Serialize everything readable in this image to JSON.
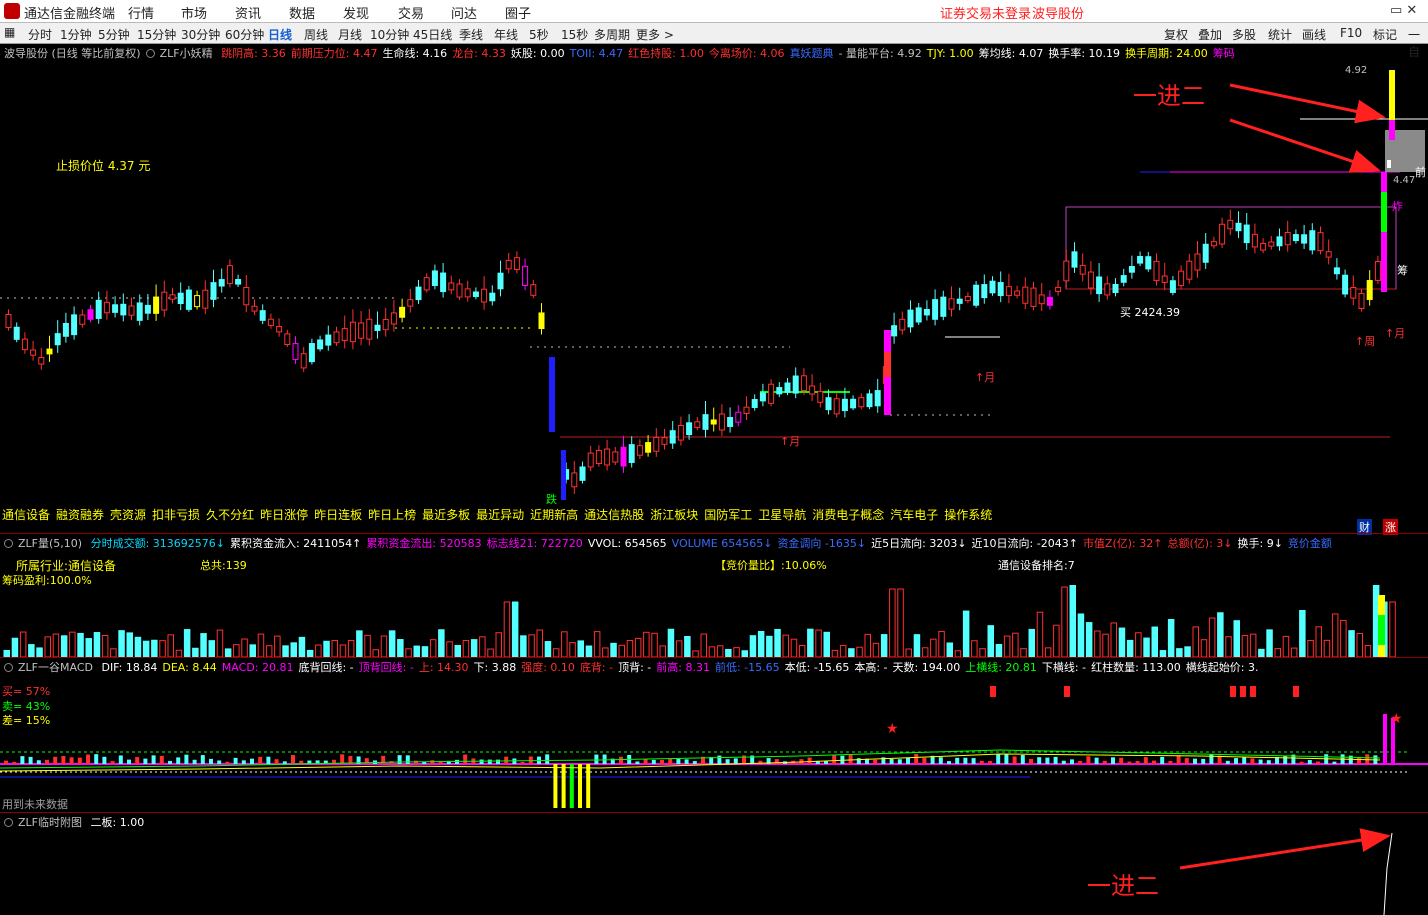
{
  "app": {
    "title": "通达信金融终端",
    "menu": [
      "行情",
      "市场",
      "资讯",
      "数据",
      "发现",
      "交易",
      "问达",
      "圈子"
    ],
    "notice": "证券交易未登录",
    "stock_name": "波导股份"
  },
  "toolbar": {
    "timeframes": [
      "分时",
      "1分钟",
      "5分钟",
      "15分钟",
      "30分钟",
      "60分钟",
      "日线",
      "周线",
      "月线",
      "10分钟",
      "45日线",
      "季线",
      "年线",
      "5秒",
      "15秒",
      "多周期",
      "更多 >"
    ],
    "active": "日线",
    "right_buttons": [
      "复权",
      "叠加",
      "多股",
      "统计",
      "画线",
      "标记",
      "一自"
    ],
    "f10": "F10"
  },
  "main_header": {
    "title": "波导股份 (日线 等比前复权)",
    "indicator": "ZLF小妖精",
    "items": [
      {
        "label": "跳阴高:",
        "value": "3.36",
        "color": "#ff3030"
      },
      {
        "label": "前期压力位:",
        "value": "4.47",
        "color": "#ff3030"
      },
      {
        "label": "生命线:",
        "value": "4.16",
        "color": "#ffffff"
      },
      {
        "label": "龙台:",
        "value": "4.33",
        "color": "#ff3030"
      },
      {
        "label": "妖股:",
        "value": "0.00",
        "color": "#ffffff"
      },
      {
        "label": "TOII:",
        "value": "4.47",
        "color": "#3a6bff"
      },
      {
        "label": "红色持股:",
        "value": "1.00",
        "color": "#ff3030"
      },
      {
        "label": "今离场价:",
        "value": "4.06",
        "color": "#ff3030"
      },
      {
        "label": "真妖题典",
        "value": "",
        "color": "#3a6bff"
      },
      {
        "label": "- 量能平台:",
        "value": "4.92",
        "color": "#c0c0c0"
      },
      {
        "label": "TJY:",
        "value": "1.00",
        "color": "#ffff00"
      },
      {
        "label": "筹均线:",
        "value": "4.07",
        "color": "#ffffff"
      },
      {
        "label": "换手率:",
        "value": "10.19",
        "color": "#ffffff"
      },
      {
        "label": "换手周期:",
        "value": "24.00",
        "color": "#ffff00"
      },
      {
        "label": "筹码",
        "value": "",
        "color": "#ff00ff"
      }
    ]
  },
  "main_chart": {
    "stop_loss": "止损价位 4.37 元",
    "price_top": "4.92",
    "price_mark": "4.47",
    "buy_label": "买 2424.39",
    "month_labels": [
      "↑月",
      "↑月",
      "↑月"
    ],
    "week_label": "↑周",
    "fall_label": "跌",
    "zha_label": "炸",
    "chou_label": "筹",
    "qian_label": "前",
    "cai_label": "财",
    "zhang_label": "涨"
  },
  "concepts": [
    "通信设备",
    "融资融券",
    "壳资源",
    "扣非亏损",
    "久不分红",
    "昨日涨停",
    "昨日连板",
    "昨日上榜",
    "最近多板",
    "最近异动",
    "近期新高",
    "通达信热股",
    "浙江板块",
    "国防军工",
    "卫星导航",
    "消费电子概念",
    "汽车电子",
    "操作系统"
  ],
  "vol_header": {
    "indicator": "ZLF量(5,10)",
    "items": [
      {
        "label": "分时成交额:",
        "value": "313692576↓",
        "color": "#00d8ff"
      },
      {
        "label": "累积资金流入:",
        "value": "2411054↑",
        "color": "#ffffff"
      },
      {
        "label": "累积资金流出:",
        "value": "520583",
        "color": "#ff00ff"
      },
      {
        "label": "标志线21:",
        "value": "722720",
        "color": "#ff00ff"
      },
      {
        "label": "VVOL:",
        "value": "654565",
        "color": "#ffffff"
      },
      {
        "label": "VOLUME",
        "value": "654565↓",
        "color": "#3a6bff"
      },
      {
        "label": "资金调向",
        "value": "-1635↓",
        "color": "#3a6bff"
      },
      {
        "label": "近5日流向:",
        "value": "3203↓",
        "color": "#ffffff"
      },
      {
        "label": "近10日流向:",
        "value": "-2043↑",
        "color": "#ffffff"
      },
      {
        "label": "市值Z(亿):",
        "value": "32↑",
        "color": "#ff3030"
      },
      {
        "label": "总额(亿):",
        "value": "3↓",
        "color": "#ff3030"
      },
      {
        "label": "换手:",
        "value": "9↓",
        "color": "#ffffff"
      },
      {
        "label": "竞价金额",
        "value": "",
        "color": "#3a6bff"
      }
    ],
    "industry": "所属行业:通信设备",
    "total": "总共:139",
    "ratio": "【竞价量比】:10.06%",
    "rank": "通信设备排名:7",
    "chip": "筹码盈利:100.0%"
  },
  "macd_header": {
    "indicator": "ZLF一谷MACD",
    "items": [
      {
        "label": "DIF:",
        "value": "18.84",
        "color": "#ffffff"
      },
      {
        "label": "DEA:",
        "value": "8.44",
        "color": "#ffff00"
      },
      {
        "label": "MACD:",
        "value": "20.81",
        "color": "#ff00ff"
      },
      {
        "label": "底背回线:",
        "value": "-",
        "color": "#ffffff"
      },
      {
        "label": "顶背回线:",
        "value": "-",
        "color": "#ff00ff"
      },
      {
        "label": "上:",
        "value": "14.30",
        "color": "#ff3030"
      },
      {
        "label": "下:",
        "value": "3.88",
        "color": "#ffffff"
      },
      {
        "label": "强度:",
        "value": "0.10",
        "color": "#ff3030"
      },
      {
        "label": "底背:",
        "value": "-",
        "color": "#ff3030"
      },
      {
        "label": "顶背:",
        "value": "-",
        "color": "#ffffff"
      },
      {
        "label": "前高:",
        "value": "8.31",
        "color": "#ff00ff"
      },
      {
        "label": "前低:",
        "value": "-15.65",
        "color": "#3a6bff"
      },
      {
        "label": "本低:",
        "value": "-15.65",
        "color": "#ffffff"
      },
      {
        "label": "本高:",
        "value": "-",
        "color": "#ffffff"
      },
      {
        "label": "天数:",
        "value": "194.00",
        "color": "#ffffff"
      },
      {
        "label": "上横线:",
        "value": "20.81",
        "color": "#00ff00"
      },
      {
        "label": "下横线:",
        "value": "-",
        "color": "#ffffff"
      },
      {
        "label": "红柱数量:",
        "value": "113.00",
        "color": "#ffffff"
      },
      {
        "label": "横线起始价:",
        "value": "3.",
        "color": "#ffffff"
      }
    ],
    "buy": "买= 57%",
    "sell": "卖= 43%",
    "diff": "差= 15%",
    "future": "用到未来数据"
  },
  "time_header": {
    "indicator": "ZLF临时附图",
    "item": "二板: 1.00"
  },
  "annotations": {
    "top": "一进二",
    "bottom": "一进二"
  }
}
